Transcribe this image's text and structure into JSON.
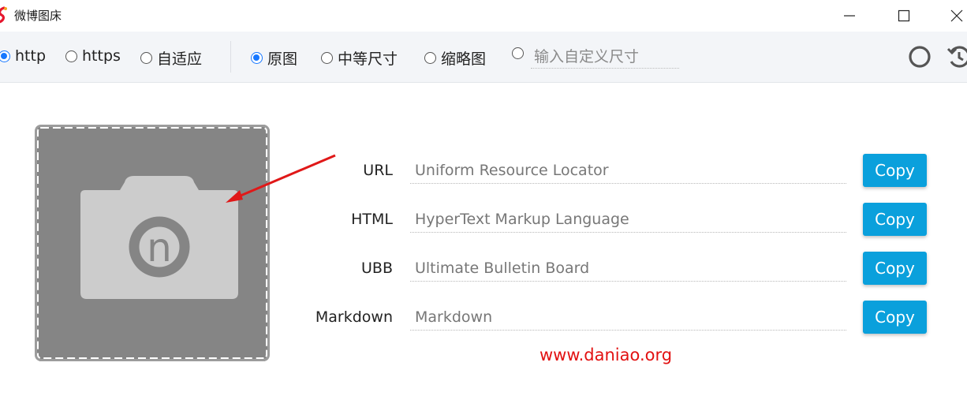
{
  "window": {
    "title": "微博图床",
    "controls": {
      "minimize": "minimize-icon",
      "maximize": "maximize-icon",
      "close": "close-icon"
    }
  },
  "toolbar": {
    "protocol_options": [
      {
        "label": "http",
        "selected": true
      },
      {
        "label": "https",
        "selected": false
      },
      {
        "label": "自适应",
        "selected": false
      }
    ],
    "size_options": [
      {
        "label": "原图",
        "selected": true
      },
      {
        "label": "中等尺寸",
        "selected": false
      },
      {
        "label": "缩略图",
        "selected": false
      }
    ],
    "custom_size": {
      "placeholder": "输入自定义尺寸",
      "value": ""
    },
    "icons": [
      "circle-icon",
      "history-icon"
    ],
    "accent_color": "#1677ff"
  },
  "upload_area": {
    "icon": "camera-icon",
    "glyph": "n"
  },
  "links": [
    {
      "label": "URL",
      "placeholder": "Uniform Resource Locator",
      "value": "",
      "button": "Copy"
    },
    {
      "label": "HTML",
      "placeholder": "HyperText Markup Language",
      "value": "",
      "button": "Copy"
    },
    {
      "label": "UBB",
      "placeholder": "Ultimate Bulletin Board",
      "value": "",
      "button": "Copy"
    },
    {
      "label": "Markdown",
      "placeholder": "Markdown",
      "value": "",
      "button": "Copy"
    }
  ],
  "button_color": "#0aa0dc",
  "watermark": {
    "text": "www.daniao.org",
    "color": "#e21111"
  }
}
